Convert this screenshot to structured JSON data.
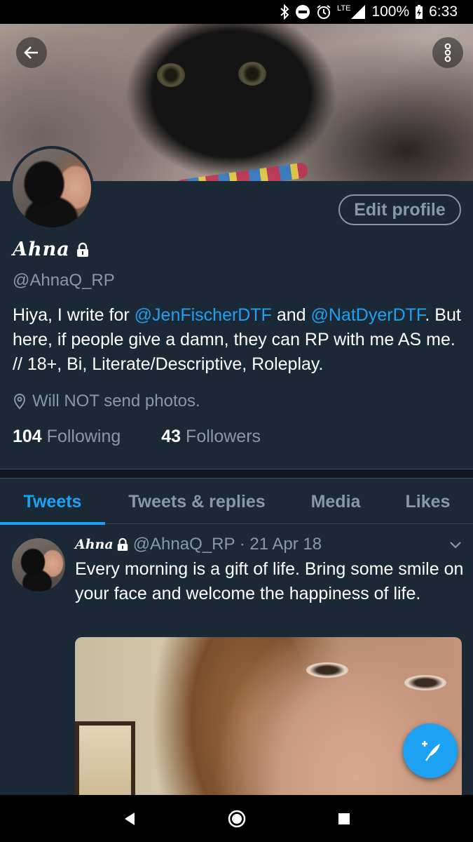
{
  "status_bar": {
    "network": "LTE",
    "battery": "100%",
    "time": "6:33",
    "icons": [
      "bluetooth-icon",
      "do-not-disturb-icon",
      "alarm-icon",
      "signal-icon",
      "battery-charging-icon"
    ]
  },
  "header": {
    "back_icon": "arrow-left-icon",
    "overflow_icon": "more-vertical-icon"
  },
  "profile": {
    "display_name": "Ahna",
    "protected_icon": "lock-icon",
    "handle": "@AhnaQ_RP",
    "edit_label": "Edit profile",
    "bio_part1": "Hiya, I write for ",
    "bio_mention1": "@JenFischerDTF",
    "bio_part2": " and ",
    "bio_mention2": "@NatDyerDTF",
    "bio_part3": ". But here, if people give a damn, they can RP with me AS me. // 18+, Bi, Literate/Descriptive, Roleplay.",
    "location": "Will NOT send photos.",
    "following_count": "104",
    "following_label": "Following",
    "followers_count": "43",
    "followers_label": "Followers"
  },
  "tabs": [
    {
      "label": "Tweets",
      "active": true
    },
    {
      "label": "Tweets & replies",
      "active": false
    },
    {
      "label": "Media",
      "active": false
    },
    {
      "label": "Likes",
      "active": false
    }
  ],
  "tweet": {
    "name": "Ahna",
    "handle_date": "@AhnaQ_RP · 21 Apr 18",
    "text": "Every morning is a gift of life. Bring some smile on your face and welcome the happiness of life."
  },
  "fab": {
    "icon": "compose-tweet-icon"
  },
  "nav": {
    "icons": [
      "back-triangle-icon",
      "home-circle-icon",
      "recents-square-icon"
    ]
  },
  "colors": {
    "accent": "#1da1f2",
    "background": "#1b2836",
    "muted": "#8899a6"
  }
}
